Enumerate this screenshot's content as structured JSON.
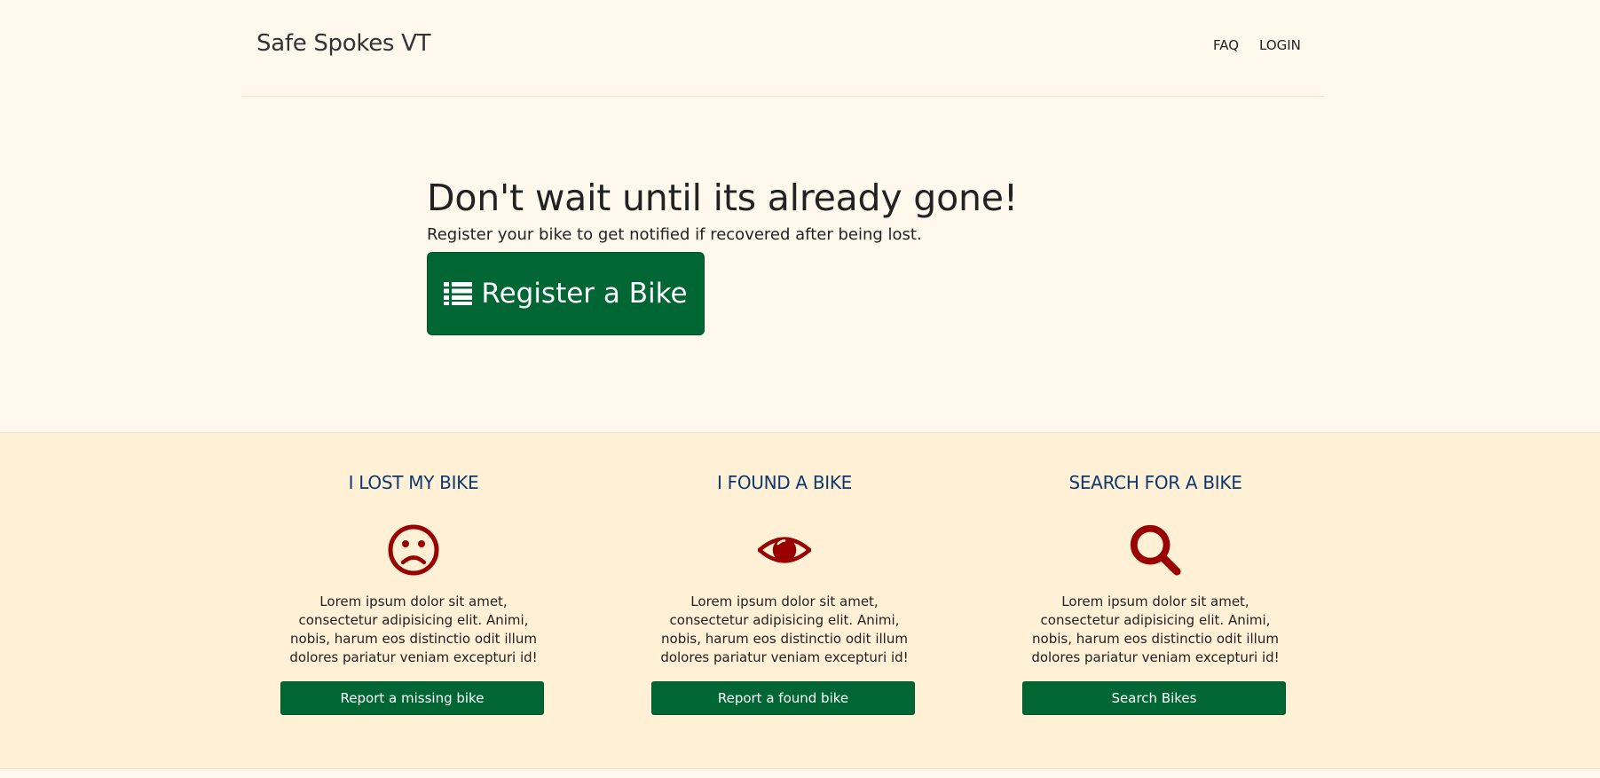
{
  "navbar": {
    "brand": "Safe Spokes VT",
    "links": [
      {
        "label": "FAQ"
      },
      {
        "label": "LOGIN"
      }
    ]
  },
  "hero": {
    "title": "Don't wait until its already gone!",
    "subtitle": "Register your bike to get notified if recovered after being lost.",
    "button_label": "Register a Bike",
    "button_icon": "list-icon"
  },
  "features": [
    {
      "title": "I LOST MY BIKE",
      "icon": "frown-icon",
      "text": "Lorem ipsum dolor sit amet, consectetur adipisicing elit. Animi, nobis, harum eos distinctio odit illum dolores pariatur veniam excepturi id!",
      "button_label": "Report a missing bike"
    },
    {
      "title": "I FOUND A BIKE",
      "icon": "eye-icon",
      "text": "Lorem ipsum dolor sit amet, consectetur adipisicing elit. Animi, nobis, harum eos distinctio odit illum dolores pariatur veniam excepturi id!",
      "button_label": "Report a found bike"
    },
    {
      "title": "SEARCH FOR A BIKE",
      "icon": "search-icon",
      "text": "Lorem ipsum dolor sit amet, consectetur adipisicing elit. Animi, nobis, harum eos distinctio odit illum dolores pariatur veniam excepturi id!",
      "button_label": "Search Bikes"
    }
  ],
  "colors": {
    "page_background": "#fff9ed",
    "features_background": "#fff0d6",
    "primary_button": "#006633",
    "feature_title": "#0d3a6e",
    "icon": "#990000"
  }
}
